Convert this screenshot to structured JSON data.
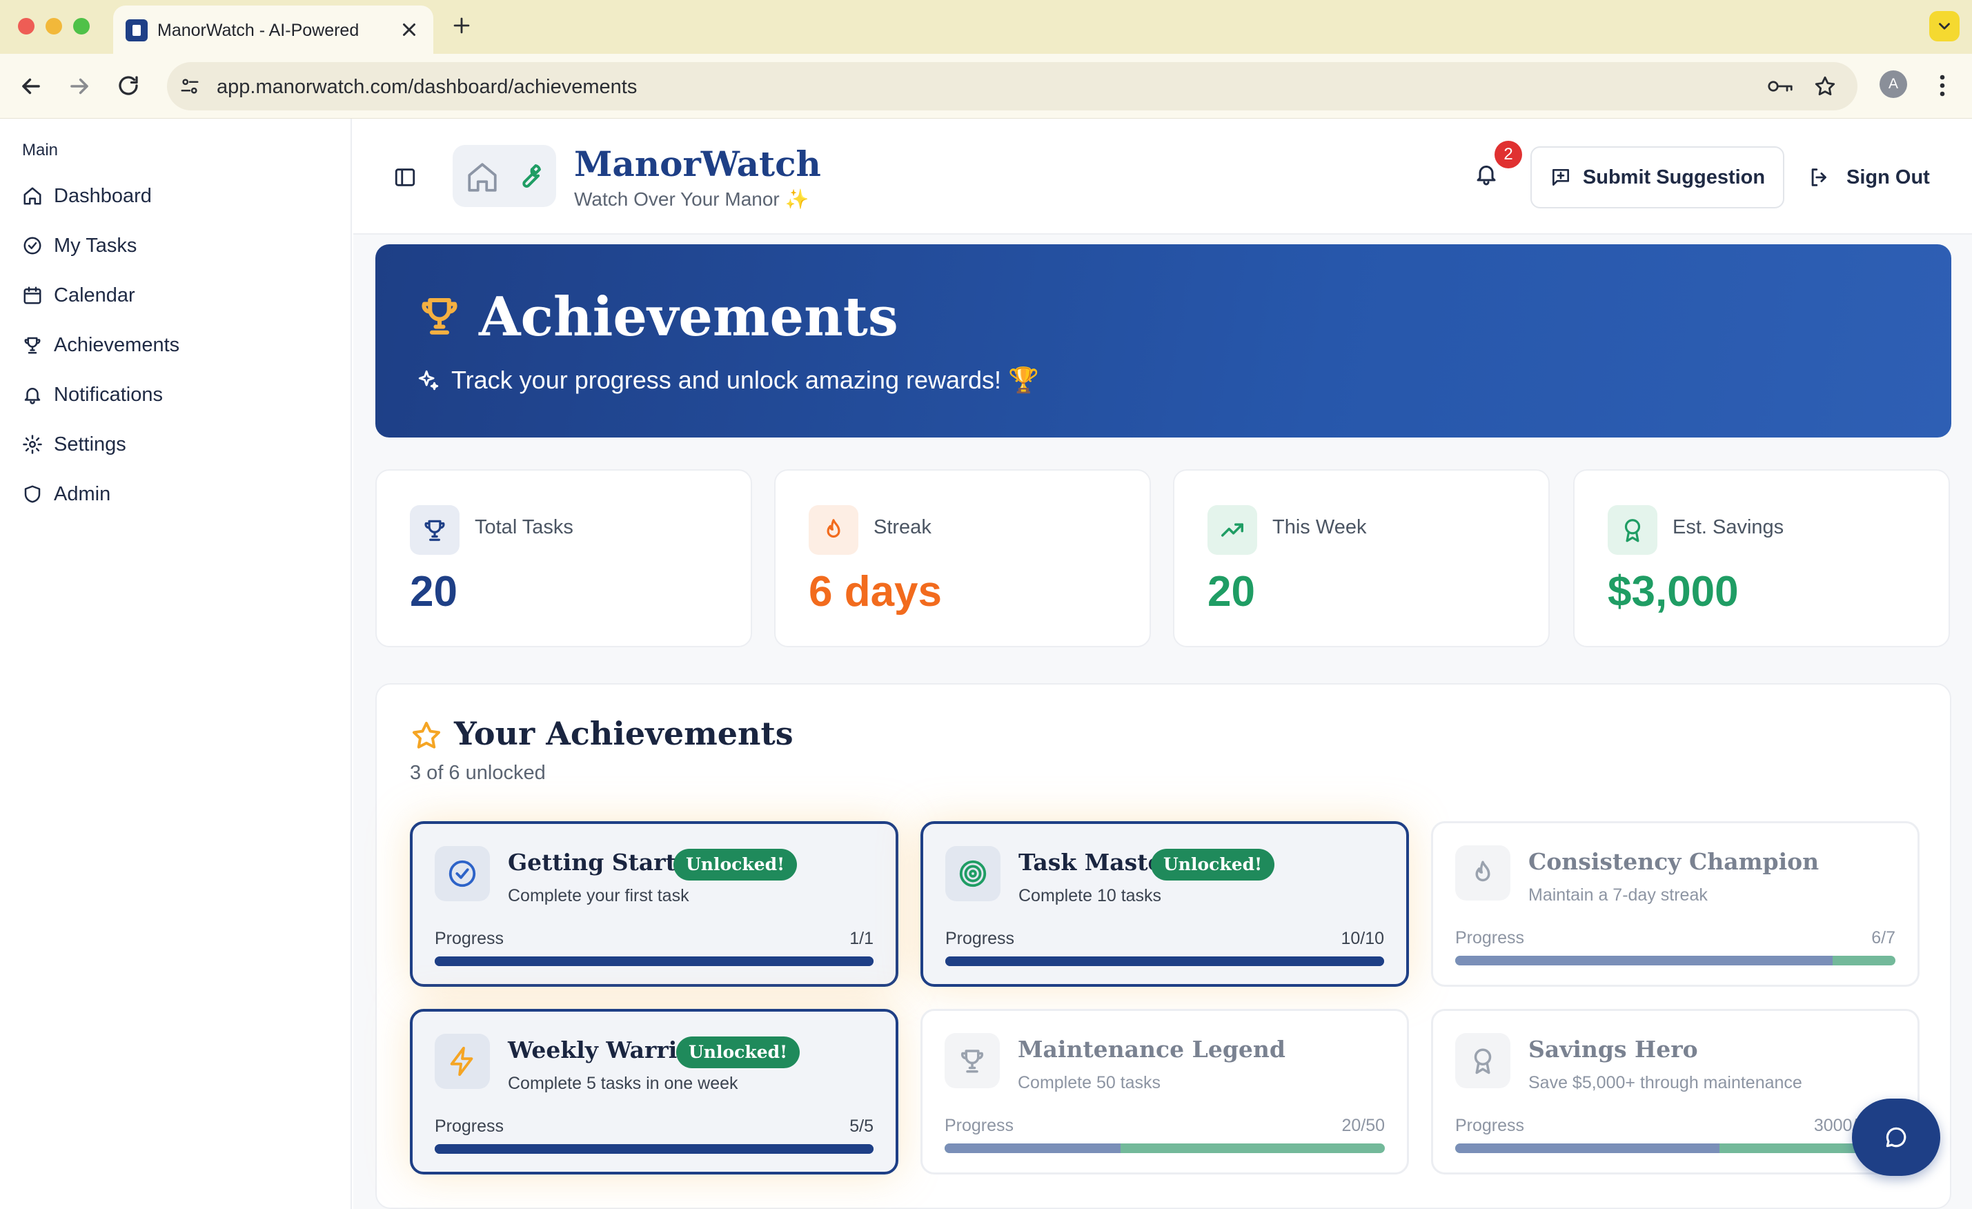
{
  "browser": {
    "tab_title": "ManorWatch - AI-Powered Home Maintenance",
    "url": "app.manorwatch.com/dashboard/achievements",
    "profile_initial": "A"
  },
  "sidebar": {
    "section_label": "Main",
    "items": [
      {
        "label": "Dashboard",
        "icon": "home-icon"
      },
      {
        "label": "My Tasks",
        "icon": "check-circle-icon"
      },
      {
        "label": "Calendar",
        "icon": "calendar-icon"
      },
      {
        "label": "Achievements",
        "icon": "trophy-icon"
      },
      {
        "label": "Notifications",
        "icon": "bell-icon"
      },
      {
        "label": "Settings",
        "icon": "gear-icon"
      },
      {
        "label": "Admin",
        "icon": "shield-icon"
      }
    ]
  },
  "header": {
    "brand": "ManorWatch",
    "tagline": "Watch Over Your Manor",
    "tagline_emoji": "✨",
    "notification_count": "2",
    "submit_suggestion": "Submit Suggestion",
    "sign_out": "Sign Out"
  },
  "hero": {
    "title": "Achievements",
    "subtitle": "Track your progress and unlock amazing rewards! 🏆"
  },
  "stats": [
    {
      "label": "Total Tasks",
      "value": "20",
      "icon": "trophy-icon",
      "color": "#1e3f86"
    },
    {
      "label": "Streak",
      "value": "6 days",
      "icon": "flame-icon",
      "color": "#f26b1d"
    },
    {
      "label": "This Week",
      "value": "20",
      "icon": "trending-up-icon",
      "color": "#1f9d64"
    },
    {
      "label": "Est. Savings",
      "value": "$3,000",
      "icon": "award-icon",
      "color": "#1f9d64"
    }
  ],
  "achievements_section": {
    "title": "Your Achievements",
    "count_text": "3 of 6 unlocked"
  },
  "achievements": [
    {
      "name": "Getting Started",
      "description": "Complete your first task",
      "progress_label": "Progress",
      "progress_text": "1/1",
      "progress": 1.0,
      "unlocked": true,
      "badge": "Unlocked!",
      "icon": "check-circle-icon"
    },
    {
      "name": "Task Master",
      "description": "Complete 10 tasks",
      "progress_label": "Progress",
      "progress_text": "10/10",
      "progress": 1.0,
      "unlocked": true,
      "badge": "Unlocked!",
      "icon": "target-icon"
    },
    {
      "name": "Consistency Champion",
      "description": "Maintain a 7-day streak",
      "progress_label": "Progress",
      "progress_text": "6/7",
      "progress": 0.857,
      "unlocked": false,
      "badge": "",
      "icon": "flame-icon"
    },
    {
      "name": "Weekly Warrior",
      "description": "Complete 5 tasks in one week",
      "progress_label": "Progress",
      "progress_text": "5/5",
      "progress": 1.0,
      "unlocked": true,
      "badge": "Unlocked!",
      "icon": "lightning-icon"
    },
    {
      "name": "Maintenance Legend",
      "description": "Complete 50 tasks",
      "progress_label": "Progress",
      "progress_text": "20/50",
      "progress": 0.4,
      "unlocked": false,
      "badge": "",
      "icon": "trophy-icon"
    },
    {
      "name": "Savings Hero",
      "description": "Save $5,000+ through maintenance",
      "progress_label": "Progress",
      "progress_text": "3000/5000",
      "progress": 0.6,
      "unlocked": false,
      "badge": "",
      "icon": "award-icon"
    }
  ],
  "colors": {
    "brand": "#1e3f86",
    "unlocked_badge": "#1f8a5b",
    "streak": "#f26b1d",
    "positive": "#1f9d64",
    "notification_badge": "#e03131"
  }
}
